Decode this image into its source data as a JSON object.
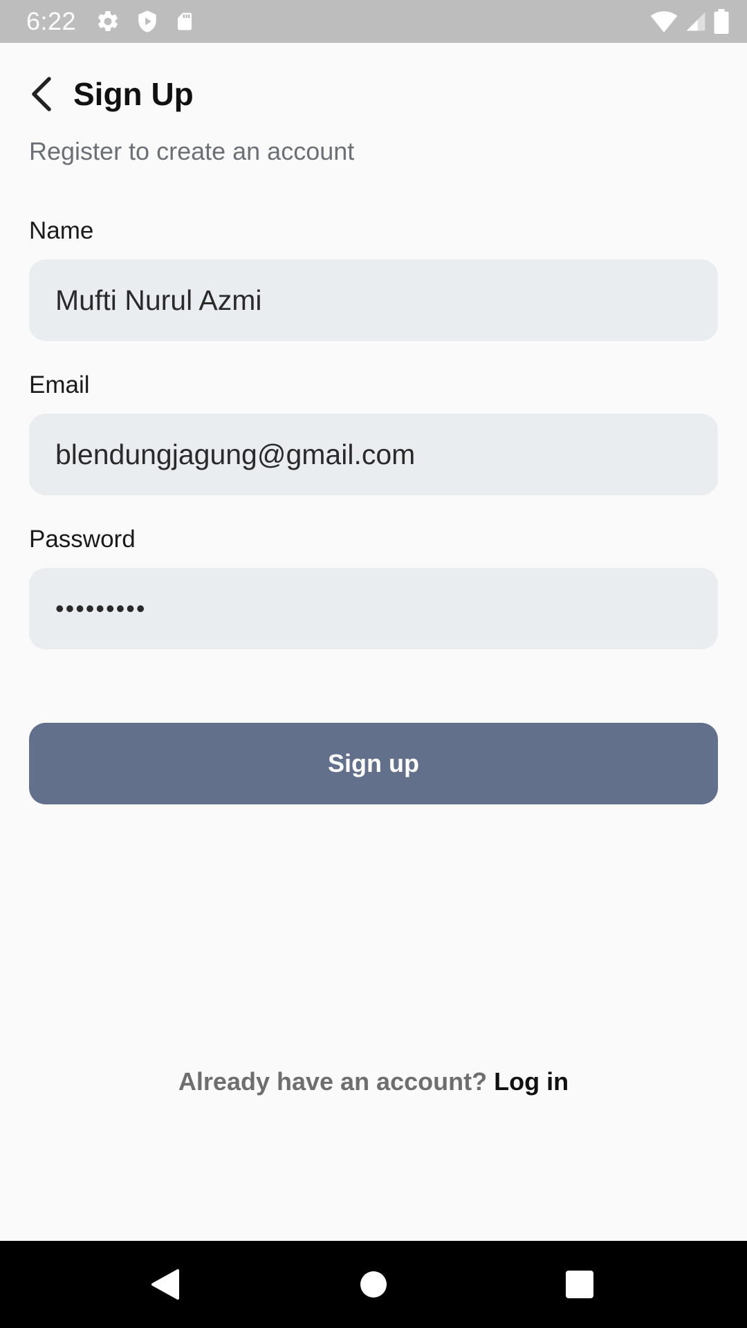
{
  "status_bar": {
    "time": "6:22",
    "left_icons": [
      "settings-icon",
      "shield-icon",
      "sd-card-icon"
    ],
    "right_icons": [
      "wifi-icon",
      "cell-signal-icon",
      "battery-icon"
    ]
  },
  "header": {
    "title": "Sign Up",
    "subtitle": "Register to create an account"
  },
  "form": {
    "name_label": "Name",
    "name_value": "Mufti Nurul Azmi",
    "email_label": "Email",
    "email_value": "blendungjagung@gmail.com",
    "password_label": "Password",
    "password_value": "•••••••••"
  },
  "actions": {
    "signup_label": "Sign up",
    "login_question": "Already have an account?",
    "login_link": "Log in"
  },
  "colors": {
    "background": "#FAFAFA",
    "status_bar": "#BDBDBD",
    "input_fill": "#EAEDF0",
    "primary_button": "#62708C",
    "nav_bar": "#000000"
  }
}
